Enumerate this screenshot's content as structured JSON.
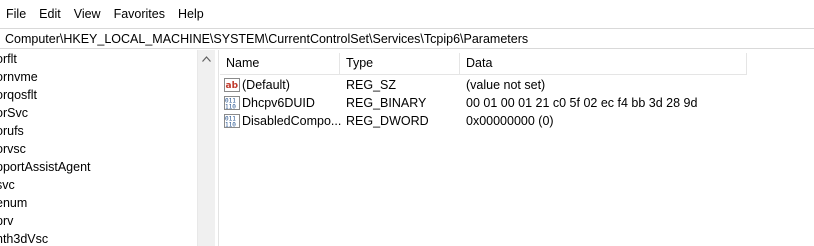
{
  "menubar": {
    "items": [
      "File",
      "Edit",
      "View",
      "Favorites",
      "Help"
    ]
  },
  "addressbar": {
    "path": "Computer\\HKEY_LOCAL_MACHINE\\SYSTEM\\CurrentControlSet\\Services\\Tcpip6\\Parameters"
  },
  "tree": {
    "items": [
      "orflt",
      "ornvme",
      "orqosflt",
      "orSvc",
      "orufs",
      "orvsc",
      "pportAssistAgent",
      "svc",
      "enum",
      "prv",
      "nth3dVsc"
    ]
  },
  "list": {
    "headers": {
      "name": "Name",
      "type": "Type",
      "data": "Data"
    },
    "rows": [
      {
        "name": "(Default)",
        "type": "REG_SZ",
        "data": "(value not set)",
        "icon": "string-value-icon"
      },
      {
        "name": "Dhcpv6DUID",
        "type": "REG_BINARY",
        "data": "00 01 00 01 21 c0 5f 02 ec f4 bb 3d 28 9d",
        "icon": "binary-value-icon"
      },
      {
        "name": "DisabledCompo...",
        "type": "REG_DWORD",
        "data": "0x00000000 (0)",
        "icon": "binary-value-icon"
      }
    ]
  },
  "colors": {
    "string_icon": "#c0392b",
    "binary_icon": "#1f4e8c",
    "separator": "#e5e5e5"
  }
}
